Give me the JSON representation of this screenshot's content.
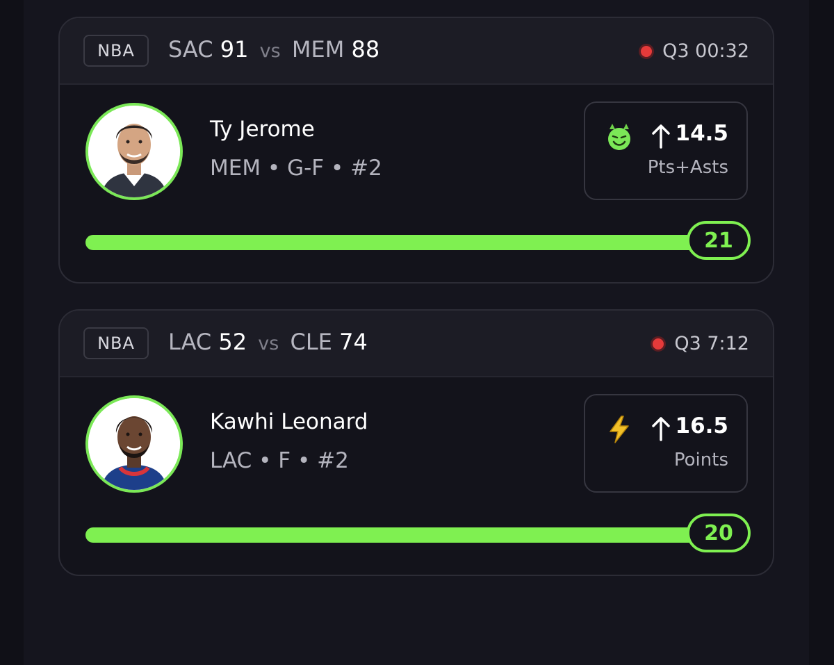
{
  "cards": [
    {
      "league": "NBA",
      "team1": "SAC",
      "score1": "91",
      "vs": "vs",
      "team2": "MEM",
      "score2": "88",
      "status": "Q3 00:32",
      "player_name": "Ty Jerome",
      "player_meta": "MEM • G-F • #2",
      "line_value": "14.5",
      "stat": "Pts+Asts",
      "line_icon": "smiling-devil-icon",
      "current": "21",
      "progress": 1.0,
      "accent": "#7ff051"
    },
    {
      "league": "NBA",
      "team1": "LAC",
      "score1": "52",
      "vs": "vs",
      "team2": "CLE",
      "score2": "74",
      "status": "Q3 7:12",
      "player_name": "Kawhi Leonard",
      "player_meta": "LAC • F • #2",
      "line_value": "16.5",
      "stat": "Points",
      "line_icon": "lightning-bolt-icon",
      "current": "20",
      "progress": 1.0,
      "accent": "#7ff051"
    }
  ]
}
